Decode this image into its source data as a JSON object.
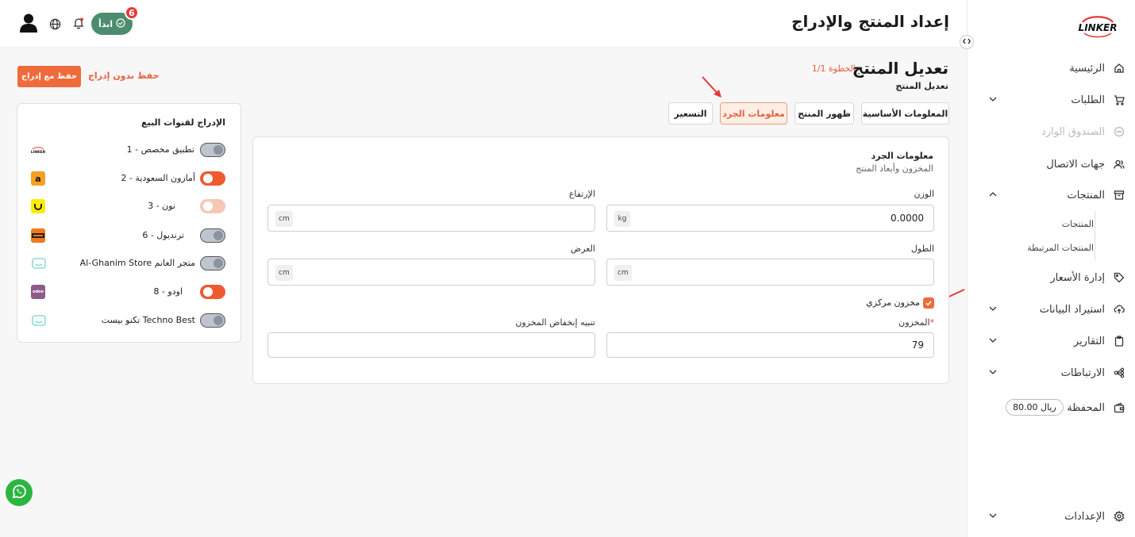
{
  "header": {
    "page_title": "إعداد المنتج والإدراج",
    "start_label": "ابدأ",
    "notification_count": "6"
  },
  "sidebar": {
    "items": [
      {
        "label": "الرئيسية",
        "icon": "home-icon"
      },
      {
        "label": "الطلبات",
        "icon": "cart-icon"
      },
      {
        "label": "الصندوق الوارد",
        "icon": "chat-icon"
      },
      {
        "label": "جهات الاتصال",
        "icon": "contacts-icon"
      },
      {
        "label": "المنتجات",
        "icon": "box-icon"
      },
      {
        "label": "إدارة الأسعار",
        "icon": "tag-icon"
      },
      {
        "label": "استيراد البيانات",
        "icon": "upload-icon"
      },
      {
        "label": "التقارير",
        "icon": "clipboard-icon"
      },
      {
        "label": "الارتباطات",
        "icon": "share-icon"
      },
      {
        "label": "المحفظة",
        "icon": "wallet-icon"
      },
      {
        "label": "الإعدادات",
        "icon": "gear-icon"
      }
    ],
    "products_sub": [
      "المنتجات",
      "المنتجات المرتبطة"
    ],
    "wallet_amount": "80.00 ريال"
  },
  "page": {
    "title": "تعديل المنتج",
    "step": "الخطوة 1/1",
    "subtitle": "تعديل المنتج",
    "save_with_listing": "حفظ مع إدراج",
    "save_without_listing": "حفظ بدون إدراج"
  },
  "tabs": [
    "المعلومات الأساسية",
    "ظهور المنتج",
    "معلومات الجرد",
    "التسعير"
  ],
  "inventory": {
    "section_title": "معلومات الجرد",
    "section_subtitle": "المخزون وأبعاد المنتج",
    "weight_label": "الوزن",
    "weight_value": "0.0000",
    "weight_unit": "kg",
    "height_label": "الإرتفاع",
    "height_unit": "cm",
    "length_label": "الطول",
    "length_unit": "cm",
    "width_label": "العرض",
    "width_unit": "cm",
    "central_stock_label": "مخزون مركزي",
    "stock_label": "المخزون",
    "stock_value": "79",
    "low_stock_label": "تنبيه إنخفاض المخزون"
  },
  "channels": {
    "title": "الإدراج لقنوات البيع",
    "items": [
      {
        "label": "تطبيق مخصص - 1",
        "state": "off"
      },
      {
        "label": "أمازون السعودية - 2",
        "state": "on"
      },
      {
        "label": "نون - 3",
        "state": "pending"
      },
      {
        "label": "ترنديول - 6",
        "state": "off"
      },
      {
        "label": "Al-Ghanim Store متجر الغانم",
        "state": "off"
      },
      {
        "label": "اودو - 8",
        "state": "on"
      },
      {
        "label": "تكنو بيست Techno Best",
        "state": "off"
      }
    ]
  },
  "colors": {
    "accent": "#ef6b3b",
    "start_green": "#4d8c6e",
    "whatsapp": "#2bb641"
  }
}
